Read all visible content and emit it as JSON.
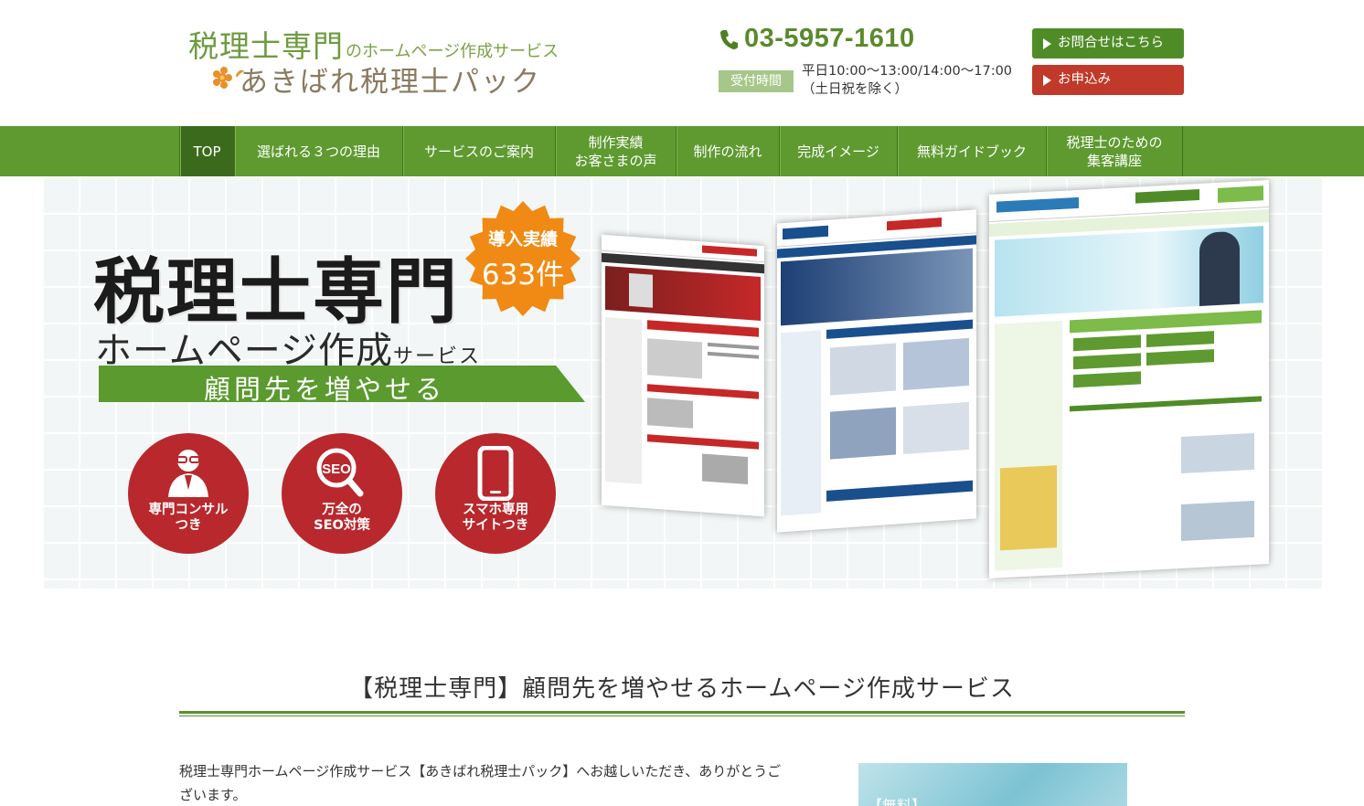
{
  "header": {
    "logo_main": "税理士専門",
    "logo_suffix": "のホームページ作成サービス",
    "logo_brand": "あきばれ税理士パック",
    "phone": "03-5957-1610",
    "hours_label": "受付時間",
    "hours_line1": "平日10:00～13:00/14:00～17:00",
    "hours_line2": "（土日祝を除く）",
    "contact_button": "お問合せはこちら",
    "apply_button": "お申込み",
    "colors": {
      "brand_green": "#5e9a30",
      "apply_red": "#c0392b",
      "phone_green": "#5a8a2c"
    }
  },
  "nav": {
    "items": [
      {
        "label": "TOP",
        "active": true
      },
      {
        "label": "選ばれる３つの理由"
      },
      {
        "label": "サービスのご案内"
      },
      {
        "label": "制作実績\nお客さまの声"
      },
      {
        "label": "制作の流れ"
      },
      {
        "label": "完成イメージ"
      },
      {
        "label": "無料ガイドブック"
      },
      {
        "label": "税理士のための\n集客講座"
      }
    ]
  },
  "hero": {
    "title": "税理士専門",
    "subtitle": "ホームページ作成",
    "subtitle_suffix": "サービス",
    "banner": "顧問先を増やせる",
    "badge_line1": "導入実績",
    "badge_line2": "633件",
    "features": [
      {
        "label": "専門コンサル\nつき",
        "icon": "consultant-icon"
      },
      {
        "label": "万全の\nSEO対策",
        "icon": "seo-search-icon"
      },
      {
        "label": "スマホ専用\nサイトつき",
        "icon": "smartphone-icon"
      }
    ]
  },
  "main": {
    "section_title": "【税理士専門】顧問先を増やせるホームページ作成サービス",
    "intro": "税理士専門ホームページ作成サービス【あきばれ税理士パック】へお越しいただき、ありがとうございます。",
    "side_banner": "【無料】"
  }
}
